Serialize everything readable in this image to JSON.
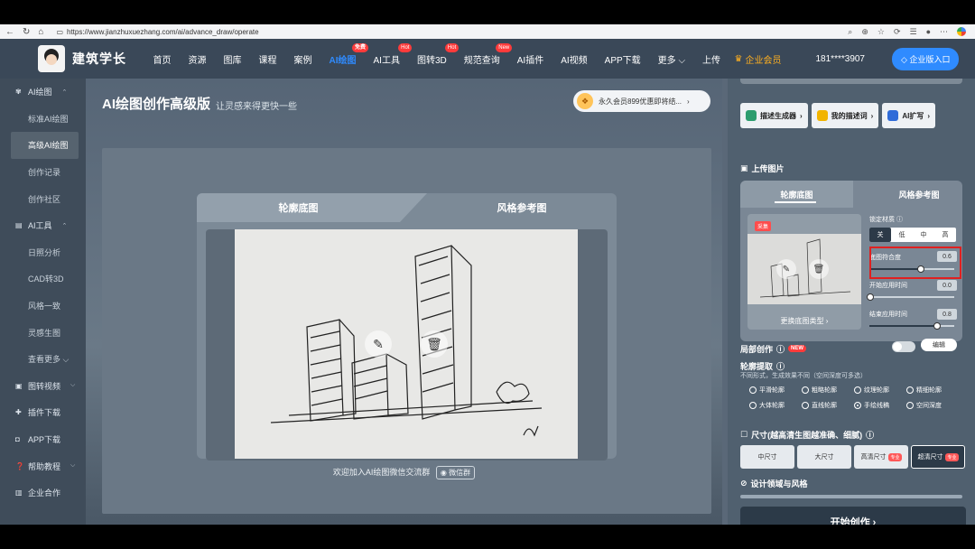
{
  "browser": {
    "url": "https://www.jianzhuxuezhang.com/ai/advance_draw/operate",
    "nav_back": "←",
    "nav_refresh": "↻",
    "nav_home": "⌂"
  },
  "header": {
    "brand": "建筑学长",
    "nav": [
      {
        "label": "首页"
      },
      {
        "label": "资源"
      },
      {
        "label": "图库"
      },
      {
        "label": "课程"
      },
      {
        "label": "案例"
      },
      {
        "label": "AI绘图",
        "badge": "免费"
      },
      {
        "label": "AI工具",
        "badge": "Hot"
      },
      {
        "label": "图转3D",
        "badge": "Hot"
      },
      {
        "label": "规范查询",
        "badge": "New"
      },
      {
        "label": "AI插件"
      },
      {
        "label": "AI视频"
      },
      {
        "label": "APP下载"
      },
      {
        "label": "更多 ⌵"
      },
      {
        "label": "上传"
      }
    ],
    "vip": "企业会员",
    "phone": "181****3907",
    "enterprise": "企业版入口"
  },
  "sidebar": {
    "items": [
      {
        "label": "AI绘图",
        "icon": "palette-icon",
        "type": "group",
        "chev": "⌃"
      },
      {
        "label": "标准AI绘图",
        "type": "sub"
      },
      {
        "label": "高级AI绘图",
        "type": "sub",
        "active": true
      },
      {
        "label": "创作记录",
        "type": "sub"
      },
      {
        "label": "创作社区",
        "type": "sub"
      },
      {
        "label": "AI工具",
        "icon": "toolbox-icon",
        "type": "group",
        "chev": "⌃"
      },
      {
        "label": "日照分析",
        "type": "sub"
      },
      {
        "label": "CAD转3D",
        "type": "sub"
      },
      {
        "label": "风格一致",
        "type": "sub"
      },
      {
        "label": "灵感生图",
        "type": "sub"
      },
      {
        "label": "查看更多 ⌵",
        "type": "sub"
      },
      {
        "label": "图转视频",
        "icon": "video-icon",
        "type": "group",
        "chev": "⌵"
      },
      {
        "label": "插件下载",
        "icon": "plugin-icon",
        "type": "group"
      },
      {
        "label": "APP下载",
        "icon": "app-icon",
        "type": "group"
      },
      {
        "label": "帮助教程",
        "icon": "help-icon",
        "type": "group",
        "chev": "⌵"
      },
      {
        "label": "企业合作",
        "icon": "building-icon",
        "type": "group"
      }
    ]
  },
  "main": {
    "title": "AI绘图创作高级版",
    "subtitle": "让灵感来得更快一些",
    "promo": "永久会员899优惠即将结...",
    "tab_outline": "轮廓底图",
    "tab_style": "风格参考图",
    "join_text": "欢迎加入AI绘图微信交流群",
    "wechat_btn": "微信群"
  },
  "right": {
    "chips": [
      {
        "label": "描述生成器",
        "color": "#2c9d6e"
      },
      {
        "label": "我的描述词",
        "color": "#f1b400"
      },
      {
        "label": "AI扩写",
        "color": "#2f6bd8"
      }
    ],
    "upload_label": "上传图片",
    "tab_outline": "轮廓底图",
    "tab_style": "风格参考图",
    "tag": "采集",
    "change_type": "更换底图类型 ›",
    "lock_material": "锁定材质",
    "lock_options": [
      "关",
      "低",
      "中",
      "高"
    ],
    "fit_label": "底图符合度",
    "fit_value": "0.6",
    "start_label": "开始应用时间",
    "start_value": "0.0",
    "end_label": "结束应用时间",
    "end_value": "0.8",
    "local_label": "局部创作",
    "new_badge": "NEW",
    "edit": "编辑",
    "outline_title": "轮廓提取",
    "outline_hint": "不同形式，生成效果不同（空间深度可多选）",
    "outline_options": [
      "平滑轮廓",
      "粗略轮廓",
      "纹理轮廓",
      "精细轮廓",
      "大体轮廓",
      "直线轮廓",
      "手绘线稿",
      "空间深度"
    ],
    "size_label": "尺寸(越高清生图越准确、细腻)",
    "sizes": [
      {
        "label": "中尺寸"
      },
      {
        "label": "大尺寸"
      },
      {
        "label": "高清尺寸",
        "pro": "专业"
      },
      {
        "label": "超清尺寸",
        "pro": "专业"
      }
    ],
    "design_label": "设计领域与风格",
    "start_btn": "开始创作 ›"
  }
}
